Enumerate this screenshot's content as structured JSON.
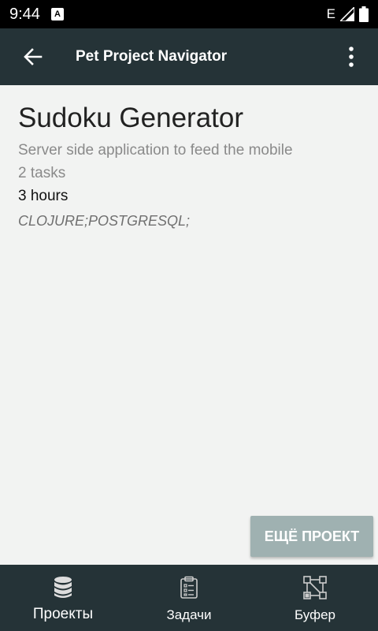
{
  "status_bar": {
    "time": "9:44",
    "app_icon_glyph": "A",
    "network_type": "E"
  },
  "app_bar": {
    "title": "Pet Project Navigator"
  },
  "project": {
    "title": "Sudoku Generator",
    "description": "Server side application to feed the mobile",
    "tasks": "2 tasks",
    "hours": "3 hours",
    "tags": "CLOJURE;POSTGRESQL;"
  },
  "actions": {
    "more_project_label": "ЕЩЁ ПРОЕКТ"
  },
  "bottom_nav": {
    "items": [
      {
        "label": "Проекты",
        "icon": "database-icon",
        "active": true
      },
      {
        "label": "Задачи",
        "icon": "clipboard-icon",
        "active": false
      },
      {
        "label": "Буфер",
        "icon": "network-icon",
        "active": false
      }
    ]
  },
  "colors": {
    "app_bar": "#253337",
    "background": "#f2f3f2",
    "button": "#9fb1b1"
  }
}
